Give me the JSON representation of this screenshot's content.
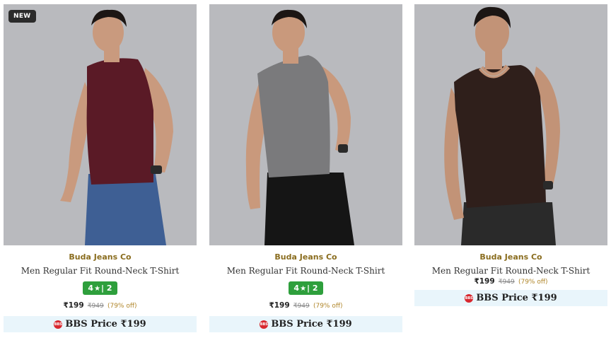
{
  "products": [
    {
      "badge": "NEW",
      "brand": "Buda Jeans Co",
      "title": "Men Regular Fit Round-Neck T-Shirt",
      "rating": {
        "score": "4",
        "count": "2",
        "separator": "|"
      },
      "price": "₹199",
      "mrp": "₹949",
      "discount": "(79% off)",
      "bbs_label": "BBS Price ₹199",
      "bbs_icon": "BBS",
      "shirt_color": "#5a1a26",
      "pants_color": "#3e5f94"
    },
    {
      "brand": "Buda Jeans Co",
      "title": "Men Regular Fit Round-Neck T-Shirt",
      "rating": {
        "score": "4",
        "count": "2",
        "separator": "|"
      },
      "price": "₹199",
      "mrp": "₹949",
      "discount": "(79% off)",
      "bbs_label": "BBS Price ₹199",
      "bbs_icon": "BBS",
      "shirt_color": "#7a7a7c",
      "pants_color": "#151515"
    },
    {
      "brand": "Buda Jeans Co",
      "title": "Men Regular Fit Round-Neck T-Shirt",
      "price": "₹199",
      "mrp": "₹949",
      "discount": "(79% off)",
      "bbs_label": "BBS Price ₹199",
      "bbs_icon": "BBS",
      "shirt_color": "#2f1f1b",
      "pants_color": "#2a2a2a"
    }
  ],
  "colors": {
    "rating_green": "#2e9f3c",
    "brand_gold": "#8a6d1f",
    "bbs_background": "#e9f5fb",
    "photo_background": "#b9babe"
  },
  "icons": {
    "rating": "star-icon",
    "bbs": "bbs-logo-icon"
  }
}
